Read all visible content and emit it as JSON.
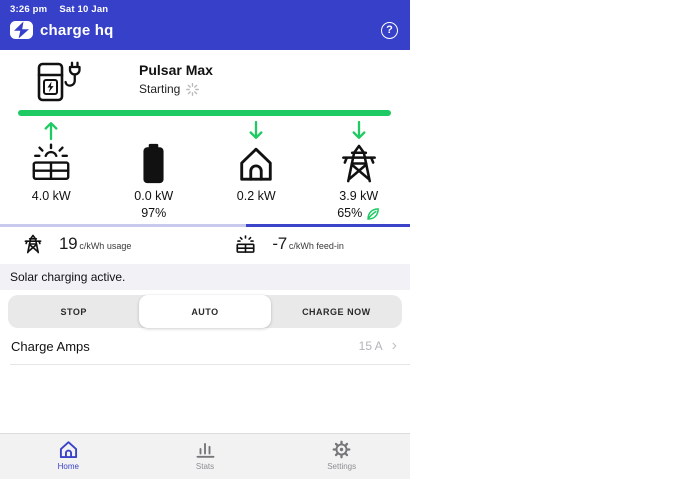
{
  "status_bar": {
    "time": "3:26 pm",
    "date": "Sat 10 Jan"
  },
  "header": {
    "app_name": "charge hq",
    "help_label": "?"
  },
  "charger": {
    "name": "Pulsar Max",
    "status": "Starting"
  },
  "power_flow": {
    "solar": {
      "value": "4.0 kW",
      "direction": "up"
    },
    "battery": {
      "value": "0.0 kW",
      "soc": "97%"
    },
    "home": {
      "value": "0.2 kW",
      "direction": "down"
    },
    "grid": {
      "value": "3.9 kW",
      "renewables": "65%",
      "direction": "down"
    }
  },
  "tariffs": {
    "usage": {
      "value": "19",
      "unit": "c/kWh usage"
    },
    "feed_in": {
      "value": "-7",
      "unit": "c/kWh feed-in"
    }
  },
  "status_message": "Solar charging active.",
  "charge_mode": {
    "stop": "STOP",
    "auto": "AUTO",
    "charge_now": "CHARGE NOW",
    "selected": "AUTO"
  },
  "charge_amps": {
    "label": "Charge Amps",
    "value": "15 A",
    "chevron": "›"
  },
  "nav": {
    "home": "Home",
    "stats": "Stats",
    "settings": "Settings"
  },
  "colors": {
    "brand_blue": "#3640c8",
    "accent_green": "#1fc963",
    "carousel_light": "#c8c9ec",
    "band_gray": "#f1f1f6"
  }
}
